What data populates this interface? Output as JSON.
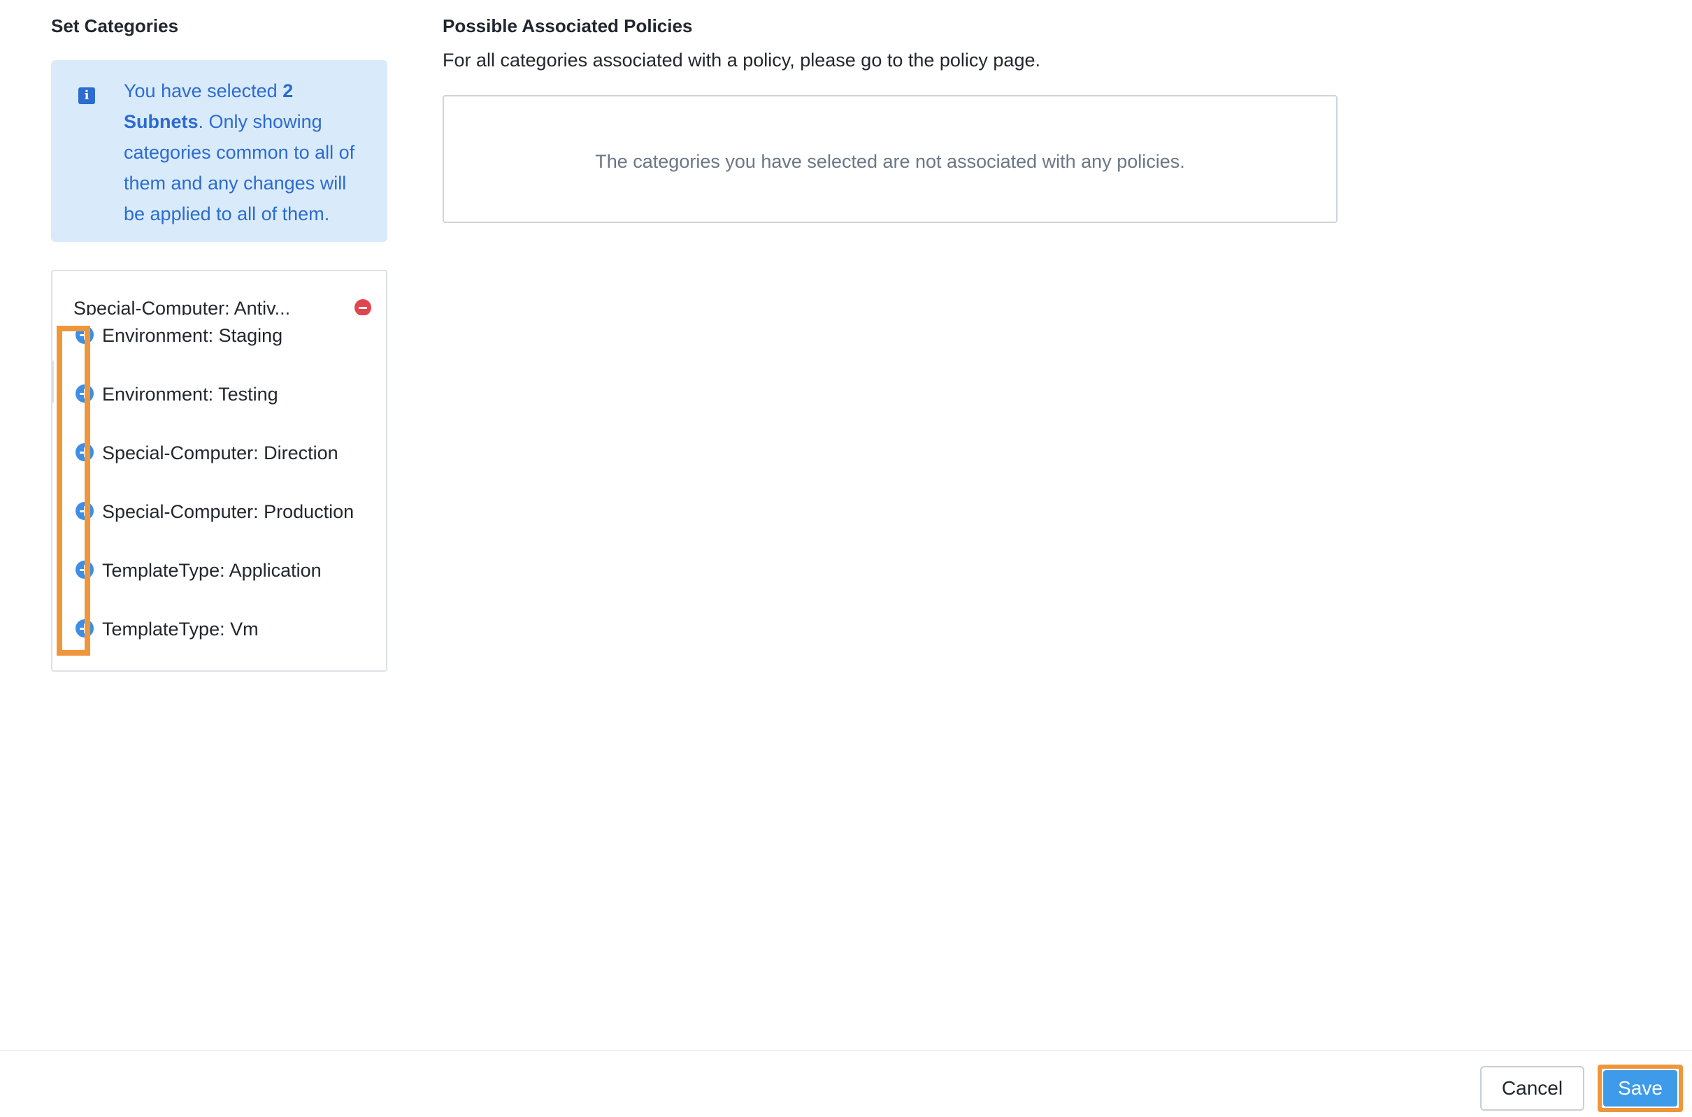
{
  "set_categories": {
    "title": "Set Categories",
    "info": {
      "prefix": "You have selected ",
      "bold": "2 Subnets",
      "suffix": ". Only showing categories common to all of them and any changes will be applied to all of them."
    },
    "selected_category": "Special-Computer: Antiv...",
    "options": [
      "Environment: Staging",
      "Environment: Testing",
      "Special-Computer: Direction",
      "Special-Computer: Production",
      "TemplateType: Application",
      "TemplateType: Vm"
    ]
  },
  "policies": {
    "title": "Possible Associated Policies",
    "description": "For all categories associated with a policy, please go to the policy page.",
    "empty_message": "The categories you have selected are not associated with any policies."
  },
  "footer": {
    "cancel_label": "Cancel",
    "save_label": "Save"
  },
  "colors": {
    "accent": "#3d9be9",
    "info_bg": "#d9ebfb",
    "info_text": "#2c6bd0",
    "remove": "#e0464e",
    "highlight": "#f0963a"
  },
  "icons": {
    "info": "info-icon",
    "remove": "remove-circle-icon",
    "add": "add-circle-icon"
  }
}
